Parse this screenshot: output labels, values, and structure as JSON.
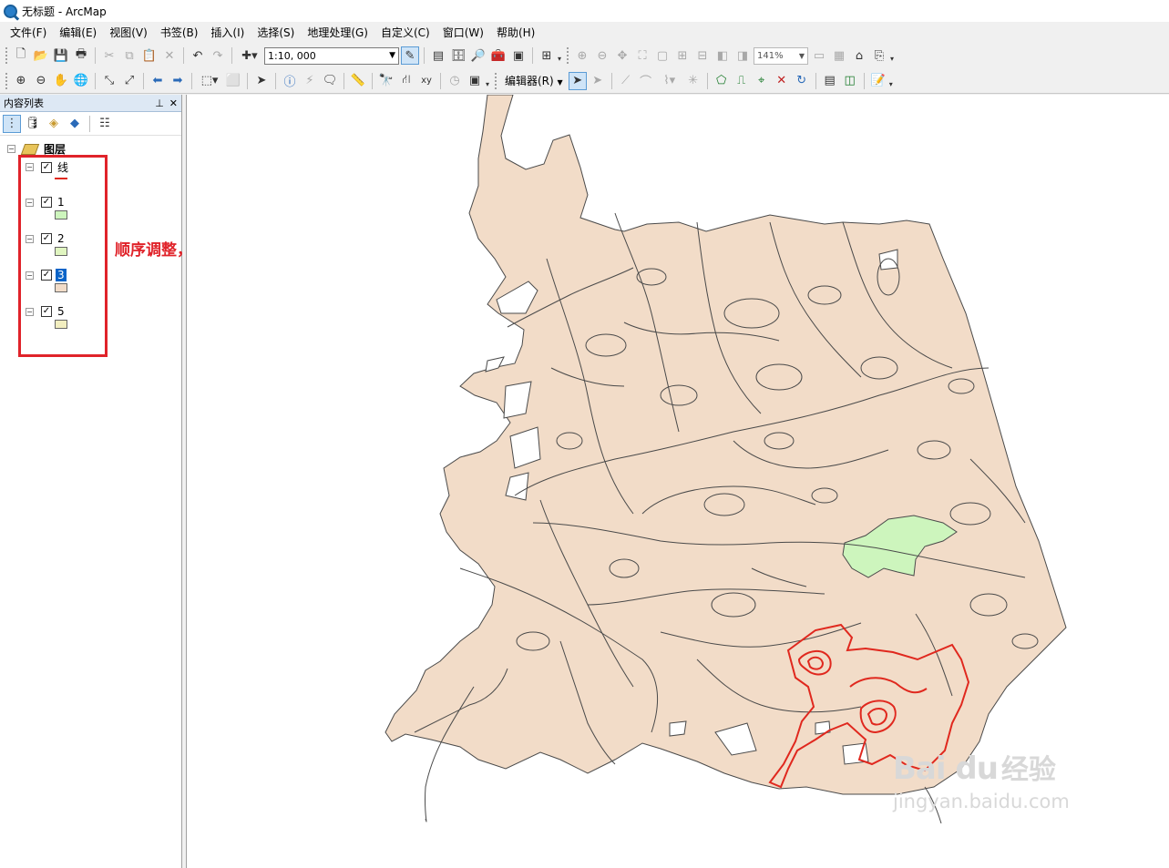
{
  "window": {
    "title": "无标题 - ArcMap"
  },
  "menu": [
    "文件(F)",
    "编辑(E)",
    "视图(V)",
    "书签(B)",
    "插入(I)",
    "选择(S)",
    "地理处理(G)",
    "自定义(C)",
    "窗口(W)",
    "帮助(H)"
  ],
  "toolbar": {
    "scale_value": "1:10, 000",
    "zoom_value": "141%",
    "editor_label": "编辑器(R)"
  },
  "toc": {
    "title": "内容列表",
    "root_label": "图层",
    "layers": [
      {
        "name": "线",
        "symbol": "line",
        "color": "#e0281e",
        "checked": true,
        "selected": false
      },
      {
        "name": "1",
        "symbol": "fill",
        "color": "#cdf5bd",
        "checked": true,
        "selected": false
      },
      {
        "name": "2",
        "symbol": "fill",
        "color": "#e0f5c0",
        "checked": true,
        "selected": false
      },
      {
        "name": "3",
        "symbol": "fill",
        "color": "#f2dcc8",
        "checked": true,
        "selected": true
      },
      {
        "name": "5",
        "symbol": "fill",
        "color": "#f2eec0",
        "checked": true,
        "selected": false
      }
    ]
  },
  "annotation": {
    "text": "顺序调整，一般为点、线、面",
    "color": "#e0232a"
  },
  "map": {
    "land_color": "#f2dcc8",
    "green_color": "#cdf5bd",
    "outline_color": "#e0281e",
    "line_color": "#4a4a4a"
  },
  "watermark": {
    "logo": "Bai du",
    "name": "经验",
    "url": "jingyan.baidu.com"
  }
}
